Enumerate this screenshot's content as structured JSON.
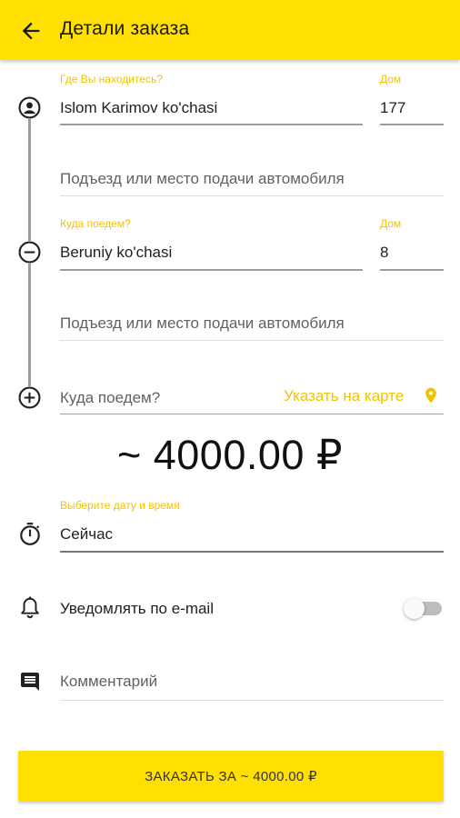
{
  "header": {
    "title": "Детали заказа"
  },
  "from": {
    "label": "Где Вы находитесь?",
    "street": "Islom Karimov ko'chasi",
    "house_label": "Дом",
    "house": "177",
    "entrance_placeholder": "Подъезд или место подачи автомобиля"
  },
  "to": {
    "label": "Куда поедем?",
    "street": "Beruniy ko'chasi",
    "house_label": "Дом",
    "house": "8",
    "entrance_placeholder": "Подъезд или место подачи автомобиля"
  },
  "add_stop": {
    "placeholder": "Куда поедем?",
    "map_link": "Указать на карте"
  },
  "price": "~ 4000.00 ₽",
  "datetime": {
    "label": "Выберите дату и время",
    "value": "Сейчас"
  },
  "notify": {
    "label": "Уведомлять по e-mail",
    "enabled": false
  },
  "comment": {
    "placeholder": "Комментарий"
  },
  "order_button": {
    "label": "ЗАКАЗАТЬ ЗА ~ 4000.00 ₽"
  },
  "colors": {
    "accent": "#ffe000",
    "label_accent": "#f2c400"
  }
}
